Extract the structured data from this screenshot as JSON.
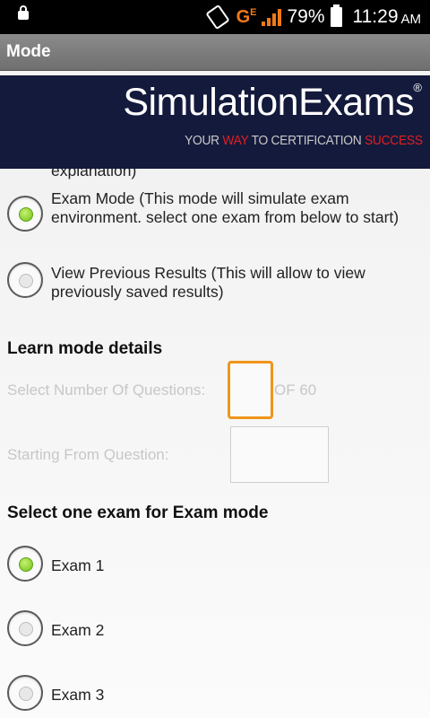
{
  "status_bar": {
    "icons": [
      "lock-icon",
      "vibrate-icon",
      "signal-icon",
      "battery-icon"
    ],
    "network_label": "G",
    "network_sub": "E",
    "battery_percent": "79%",
    "time": "11:29",
    "ampm": "AM"
  },
  "action_bar": {
    "title": "Mode"
  },
  "banner": {
    "brand": "SimulationExams",
    "reg_mark": "®",
    "tagline_parts": [
      "YOUR ",
      "WAY",
      " TO CERTIFICATION ",
      "SUCCESS"
    ]
  },
  "mode_options": {
    "partial_text": "explanation)",
    "exam_mode": "Exam Mode   (This mode will simulate exam environment. select one exam from below to start)",
    "view_results": "View Previous Results    (This will allow to view previously saved results)"
  },
  "learn_details": {
    "heading": "Learn mode details",
    "select_questions_label": "Select Number Of Questions:",
    "of_label": "OF 60",
    "starting_from_label": "Starting From Question:",
    "questions_value": "",
    "starting_value": ""
  },
  "exam_selection": {
    "heading": "Select one exam for Exam mode",
    "exams": [
      "Exam 1",
      "Exam 2",
      "Exam 3"
    ]
  },
  "colors": {
    "accent_orange": "#f0951a",
    "radio_green": "#6fc21a",
    "banner_bg": "#141a3c",
    "tagline_red": "#e02020"
  }
}
